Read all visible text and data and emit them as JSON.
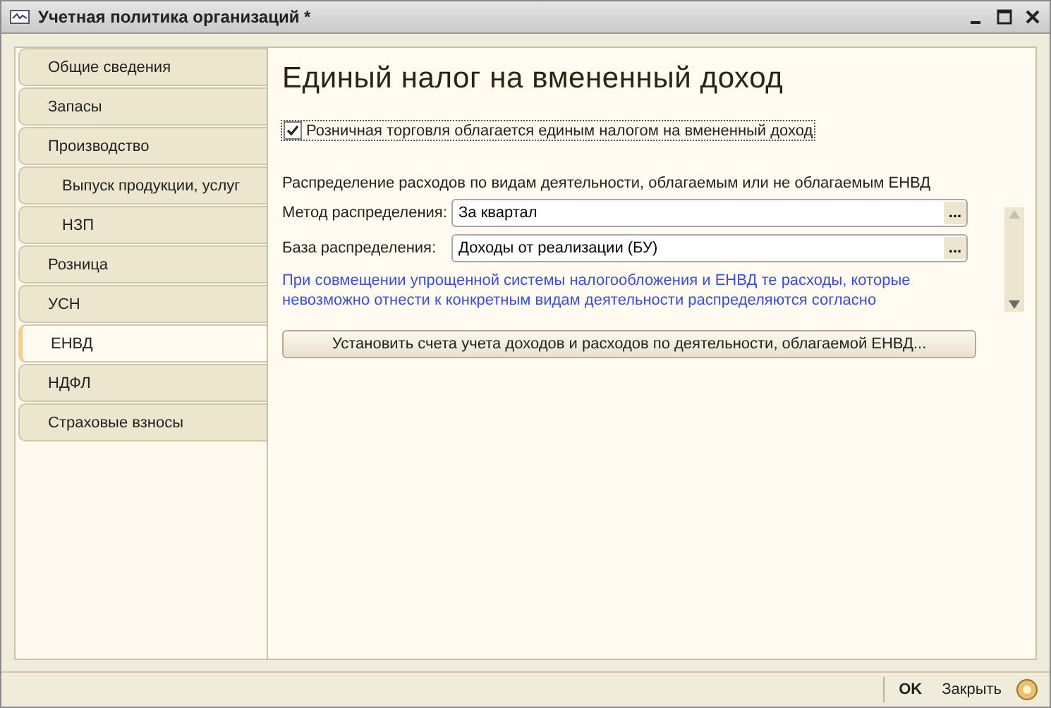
{
  "window": {
    "title": "Учетная политика организаций *"
  },
  "sidebar": {
    "items": [
      {
        "label": "Общие сведения",
        "selected": false
      },
      {
        "label": "Запасы",
        "selected": false
      },
      {
        "label": "Производство",
        "selected": false,
        "children": [
          {
            "label": "Выпуск продукции, услуг",
            "selected": false
          },
          {
            "label": "НЗП",
            "selected": false
          }
        ]
      },
      {
        "label": "Розница",
        "selected": false
      },
      {
        "label": "УСН",
        "selected": false
      },
      {
        "label": "ЕНВД",
        "selected": true
      },
      {
        "label": "НДФЛ",
        "selected": false
      },
      {
        "label": "Страховые взносы",
        "selected": false
      }
    ]
  },
  "content": {
    "heading": "Единый налог на вмененный доход",
    "retail_checkbox": {
      "label": "Розничная торговля облагается единым налогом на вмененный доход",
      "checked": true
    },
    "section_label": "Распределение расходов по видам деятельности, облагаемым или не облагаемым ЕНВД",
    "fields": [
      {
        "label": "Метод распределения:",
        "value": "За квартал",
        "button": "..."
      },
      {
        "label": "База распределения:",
        "value": "Доходы от реализации (БУ)",
        "button": "..."
      }
    ],
    "note": "При совмещении упрощенной системы налогообложения и ЕНВД те расходы, которые невозможно отнести к конкретным видам деятельности распределяются согласно",
    "accounts_button": "Установить счета учета доходов и расходов по деятельности, облагаемой ЕНВД..."
  },
  "footer": {
    "buttons": [
      "OK",
      "Закрыть"
    ]
  }
}
